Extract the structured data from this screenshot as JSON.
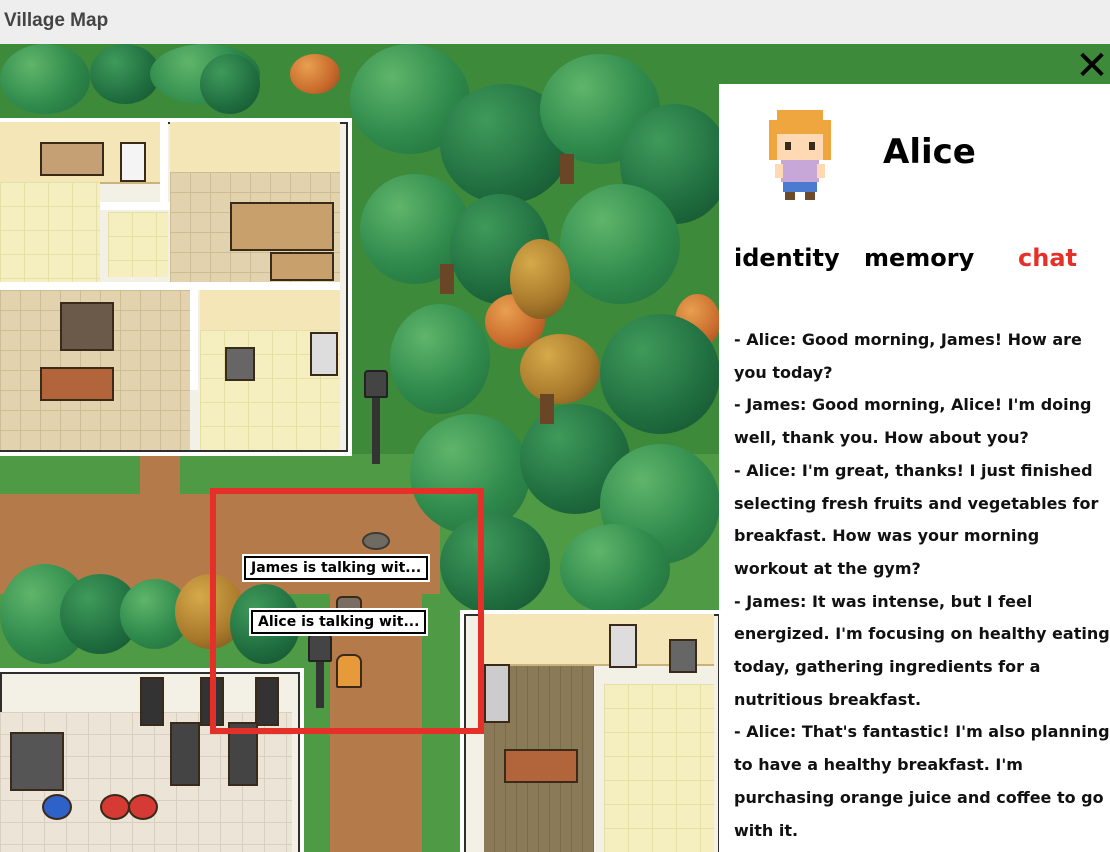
{
  "window": {
    "title": "Village Map"
  },
  "map": {
    "bubbles": [
      {
        "label": "James is talking wit..."
      },
      {
        "label": "Alice is talking wit..."
      }
    ],
    "highlight_color": "#e53029"
  },
  "panel": {
    "close_icon": "close-icon",
    "character_name": "Alice",
    "tabs": [
      {
        "label": "identity",
        "active": false
      },
      {
        "label": "memory",
        "active": false
      },
      {
        "label": "chat",
        "active": true
      }
    ],
    "active_color": "#e53029",
    "chat_lines": [
      "- Alice: Good morning, James! How are you today?",
      "- James: Good morning, Alice! I'm doing well, thank you. How about you?",
      "- Alice: I'm great, thanks! I just finished selecting fresh fruits and vegetables for breakfast. How was your morning workout at the gym?",
      "- James: It was intense, but I feel energized. I'm focusing on healthy eating today, gathering ingredients for a nutritious breakfast.",
      "- Alice: That's fantastic! I'm also planning to have a healthy breakfast. I'm purchasing orange juice and coffee to go with it."
    ]
  }
}
